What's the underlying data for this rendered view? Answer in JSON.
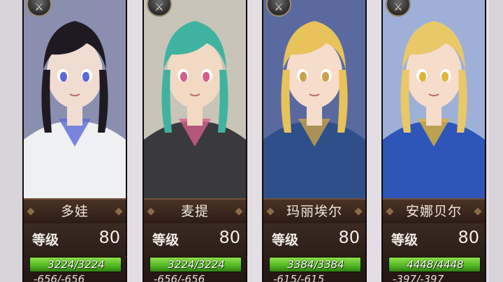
{
  "characters": [
    {
      "name": "多娃",
      "level_label": "等级",
      "level": "80",
      "hp_text": "3224/3224",
      "hp_fraction": 1.0,
      "secondary_text": "-656/-656",
      "weapon_icon": "sword-icon",
      "colors": {
        "hair": "#1f1a22",
        "skin": "#f1dcd2",
        "outfit": "#eef0f2",
        "accent": "#5b6ad6",
        "bg": "#8a8fb0"
      }
    },
    {
      "name": "麦提",
      "level_label": "等级",
      "level": "80",
      "hp_text": "3224/3224",
      "hp_fraction": 1.0,
      "secondary_text": "-656/-656",
      "weapon_icon": "sword-icon",
      "colors": {
        "hair": "#3fb3a0",
        "skin": "#f2d9c4",
        "outfit": "#3a3a3e",
        "accent": "#d45f8a",
        "bg": "#c9c4b8"
      }
    },
    {
      "name": "玛丽埃尔",
      "level_label": "等级",
      "level": "80",
      "hp_text": "3384/3384",
      "hp_fraction": 1.0,
      "secondary_text": "-615/-615",
      "weapon_icon": "sword-icon",
      "colors": {
        "hair": "#e8c25a",
        "skin": "#f6dccb",
        "outfit": "#2f4f8a",
        "accent": "#c9a24a",
        "bg": "#5a6aa0"
      }
    },
    {
      "name": "安娜贝尔",
      "level_label": "等级",
      "level": "80",
      "hp_text": "4448/4448",
      "hp_fraction": 1.0,
      "secondary_text": "-397/-397",
      "weapon_icon": "sword-icon",
      "colors": {
        "hair": "#e9c86a",
        "skin": "#f6dccb",
        "outfit": "#2d56b8",
        "accent": "#e0b43a",
        "bg": "#9fb0d8"
      }
    }
  ]
}
